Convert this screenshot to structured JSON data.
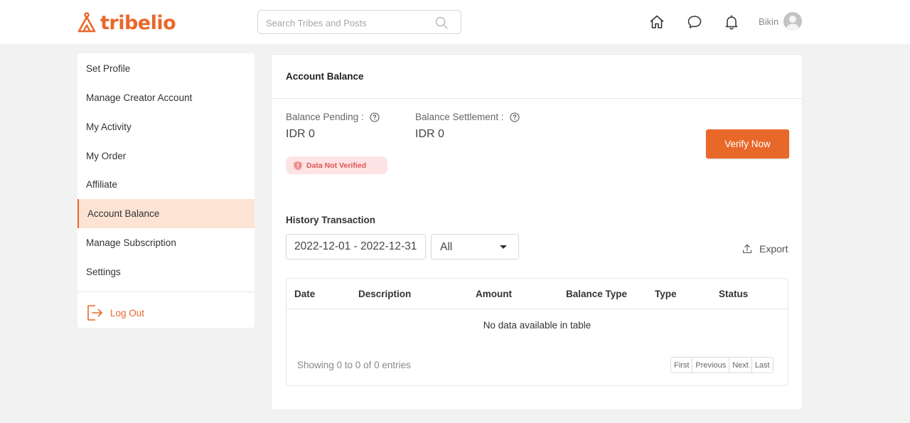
{
  "header": {
    "brand": "tribelio",
    "search_placeholder": "Search Tribes and Posts",
    "icons": [
      "home-icon",
      "chat-icon",
      "bell-icon"
    ],
    "user_name": "Bikin"
  },
  "sidebar": {
    "items": [
      {
        "label": "Set Profile"
      },
      {
        "label": "Manage Creator Account"
      },
      {
        "label": "My Activity"
      },
      {
        "label": "My Order"
      },
      {
        "label": "Affiliate"
      },
      {
        "label": "Account Balance",
        "active": true
      },
      {
        "label": "Manage Subscription"
      },
      {
        "label": "Settings"
      }
    ],
    "logout_label": "Log Out"
  },
  "main": {
    "title": "Account Balance",
    "balance_pending_label": "Balance Pending :",
    "balance_pending_value": "IDR 0",
    "balance_settlement_label": "Balance Settlement :",
    "balance_settlement_value": "IDR 0",
    "status_badge": "Data Not Verified",
    "verify_button": "Verify Now",
    "history_title": "History Transaction",
    "date_range": "2022-12-01 - 2022-12-31",
    "filter_value": "All",
    "export_label": "Export",
    "table": {
      "columns": [
        "Date",
        "Description",
        "Amount",
        "Balance Type",
        "Type",
        "Status"
      ],
      "rows": [],
      "empty_text": "No data available in table",
      "info": "Showing 0 to 0 of 0 entries",
      "pager": [
        "First",
        "Previous",
        "Next",
        "Last"
      ]
    }
  },
  "colors": {
    "accent": "#e8682a",
    "active_bg": "#fde3d4",
    "badge_bg": "#fde3e3",
    "badge_text": "#e05555"
  }
}
